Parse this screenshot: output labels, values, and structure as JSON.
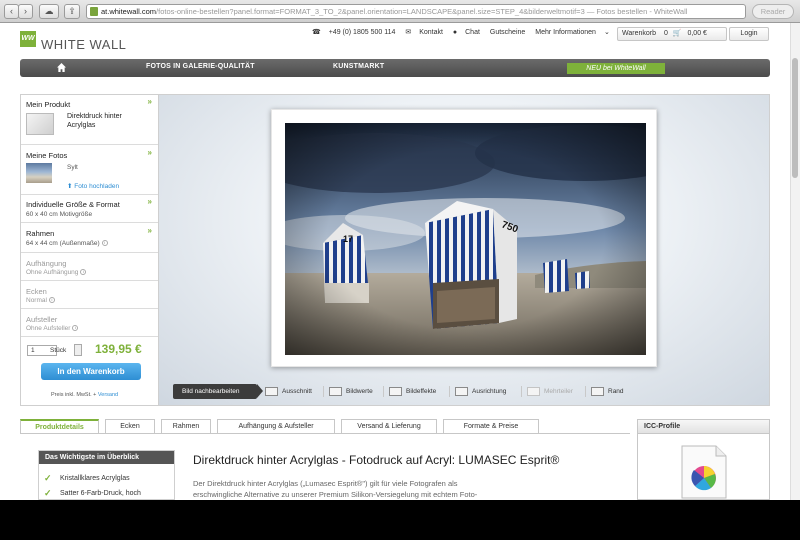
{
  "browser": {
    "url_host": "at.whitewall.com",
    "url_rest": "/fotos-online-bestellen?panel.format=FORMAT_3_TO_2&panel.orientation=LANDSCAPE&panel.size=STEP_4&bilderweltmotif=3 — Fotos bestellen - WhiteWall",
    "reader_label": "Reader"
  },
  "header": {
    "logo_mark": "WW",
    "logo_text": "WHITE WALL",
    "phone": "+49 (0) 1805 500 114",
    "contact": "Kontakt",
    "chat": "Chat",
    "vouchers": "Gutscheine",
    "more_info": "Mehr Informationen",
    "cart_label": "Warenkorb",
    "cart_count": "0",
    "cart_total": "0,00 €",
    "login": "Login"
  },
  "mainnav": {
    "items": [
      "FOTOS IN GALERIE-QUALITÄT",
      "KUNSTMARKT"
    ],
    "neu": "NEU bei WhiteWall"
  },
  "panel": {
    "product_title": "Mein Produkt",
    "product_line1": "Direktdruck hinter",
    "product_line2": "Acrylglas",
    "photos_title": "Meine Fotos",
    "photo_name": "Sylt",
    "upload": "Foto hochladen",
    "size_title": "Individuelle Größe & Format",
    "size_value": "60 x 40 cm Motivgröße",
    "frame_title": "Rahmen",
    "frame_value": "64 x 44 cm (Außenmaße)",
    "hanging_title": "Aufhängung",
    "hanging_value": "Ohne Aufhängung",
    "corners_title": "Ecken",
    "corners_value": "Normal",
    "stand_title": "Aufsteller",
    "stand_value": "Ohne Aufsteller",
    "qty": "1",
    "qty_unit": "Stück",
    "price": "139,95 €",
    "cart_button": "In den Warenkorb",
    "vat": "Preis inkl. MwSt. +",
    "shipping": "Versand"
  },
  "editbar": {
    "label": "Bild nachbearbeiten",
    "tools": [
      "Ausschnitt",
      "Bildwerte",
      "Bildeffekte",
      "Ausrichtung",
      "Mehrteiler",
      "Rand"
    ]
  },
  "photo": {
    "chair_left_number": "17",
    "chair_main_number": "750"
  },
  "tabs": [
    "Produktdetails",
    "Ecken",
    "Rahmen",
    "Aufhängung & Aufsteller",
    "Versand & Lieferung",
    "Formate & Preise"
  ],
  "icc": {
    "title": "ICC-Profile"
  },
  "details": {
    "box_title": "Das Wichtigste im Überblick",
    "bullets": [
      "Kristallklares Acrylglas",
      "Satter 6-Farb-Druck, hoch"
    ],
    "heading": "Direktdruck hinter Acrylglas - Fotodruck auf Acryl: LUMASEC Esprit®",
    "desc_line1": "Der Direktdruck hinter Acrylglas („Lumasec Esprit®\") gilt für viele Fotografen als",
    "desc_line2": "erschwingliche Alternative zu unserer Premium Silikon-Versiegelung mit echtem Foto-"
  },
  "colors": {
    "accent_green": "#7eb13a",
    "cart_blue": "#2e8ed3",
    "nav_dark": "#555555"
  }
}
